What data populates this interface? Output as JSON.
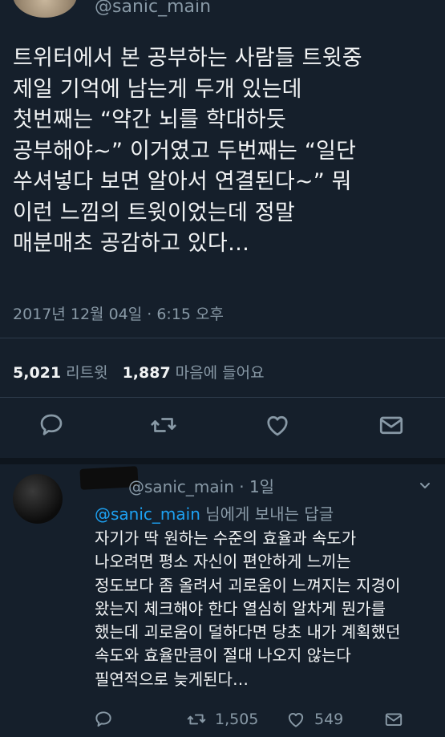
{
  "top": {
    "handle": "@sanic_main"
  },
  "tweet": {
    "lines": [
      "트위터에서 본 공부하는 사람들 트윗중",
      "제일 기억에 남는게 두개 있는데",
      "첫번째는 “약간 뇌를 학대하듯",
      "공부해야~” 이거였고 두번째는 “일단",
      "쑤셔넣다 보면 알아서 연결된다~” 뭐",
      "이런 느낌의 트윗이었는데 정말",
      "매분매초 공감하고 있다…"
    ],
    "date": "2017년 12월 04일 · 6:15 오후",
    "retweets": "5,021",
    "retweets_label": "리트윗",
    "likes": "1,887",
    "likes_label": "마음에 들어요"
  },
  "icons": {
    "reply": "reply-icon",
    "retweet": "retweet-icon",
    "like": "heart-icon",
    "message": "envelope-icon",
    "more": "chevron-down-icon"
  },
  "reply": {
    "header": "@sanic_main · 1일",
    "reply_to_mention": "@sanic_main",
    "reply_to_suffix": " 님에게 보내는 답글",
    "lines": [
      "자기가 딱 원하는 수준의 효율과 속도가",
      "나오려면 평소 자신이 편안하게 느끼는",
      "정도보다 좀 올려서 괴로움이 느껴지는 지경이",
      "왔는지 체크해야 한다 열심히 알차게 뭔가를",
      "했는데 괴로움이 덜하다면 당초 내가 계획했던",
      "속도와 효율만큼이 절대 나오지 않는다",
      "필연적으로 늦게된다…"
    ],
    "retweet_count": "1,505",
    "like_count": "549"
  },
  "colors": {
    "background": "#151f2b",
    "text": "#f1f3f4",
    "muted": "#8899a6",
    "link": "#1da1f2"
  }
}
